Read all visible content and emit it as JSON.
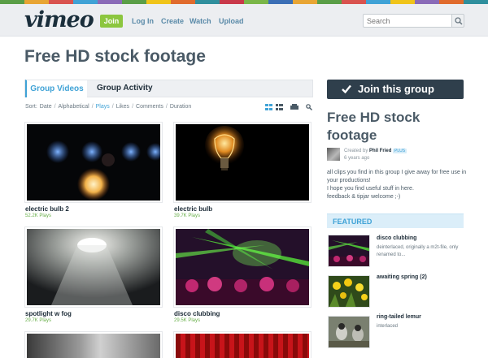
{
  "stripe_colors": [
    "#5a9e47",
    "#e8a534",
    "#d9534f",
    "#3fa2d6",
    "#8a6bb8",
    "#5a9e47",
    "#f0c419",
    "#e06b2d",
    "#2f8f9d",
    "#c9394a",
    "#7ab648",
    "#3b6fb6",
    "#e8a534",
    "#5a9e47",
    "#d9534f",
    "#3fa2d6",
    "#f0c419",
    "#8a6bb8",
    "#e06b2d",
    "#2f8f9d"
  ],
  "header": {
    "logo": "vimeo",
    "join": "Join",
    "nav": [
      "Log In",
      "Create",
      "Watch",
      "Upload"
    ],
    "search_placeholder": "Search"
  },
  "page_title": "Free HD stock footage",
  "tabs": {
    "active": "Group Videos",
    "other": "Group Activity"
  },
  "sort": {
    "label": "Sort:",
    "options": [
      "Date",
      "Alphabetical",
      "Plays",
      "Likes",
      "Comments",
      "Duration"
    ],
    "active": "Plays"
  },
  "videos": [
    {
      "title": "electric bulb 2",
      "plays": "52.2K Plays"
    },
    {
      "title": "electric bulb",
      "plays": "39.7K Plays"
    },
    {
      "title": "spotlight w fog",
      "plays": "29.7K Plays"
    },
    {
      "title": "disco clubbing",
      "plays": "29.5K Plays"
    }
  ],
  "sidebar": {
    "join_button": "Join this group",
    "group_title": "Free HD stock footage",
    "created_by_prefix": "Created by",
    "creator": "Phil Fried",
    "badge": "PLUS",
    "age": "6 years ago",
    "description": "all clips you find in this group I give away for free use in your productions!\nI hope you find useful stuff in here.\nfeedback & tipjar welcome ;-)",
    "featured_label": "FEATURED",
    "featured": [
      {
        "title": "disco clubbing",
        "desc": "deinterlaced, originally a m2t-file, only renamed to..."
      },
      {
        "title": "awaiting spring (2)",
        "desc": ""
      },
      {
        "title": "ring-tailed lemur",
        "desc": "interlaced"
      }
    ]
  },
  "colors": {
    "accent": "#3fa2d6",
    "join_green": "#8cc63f",
    "dark_button": "#2f3f4c",
    "plays_green": "#6ab04c"
  }
}
